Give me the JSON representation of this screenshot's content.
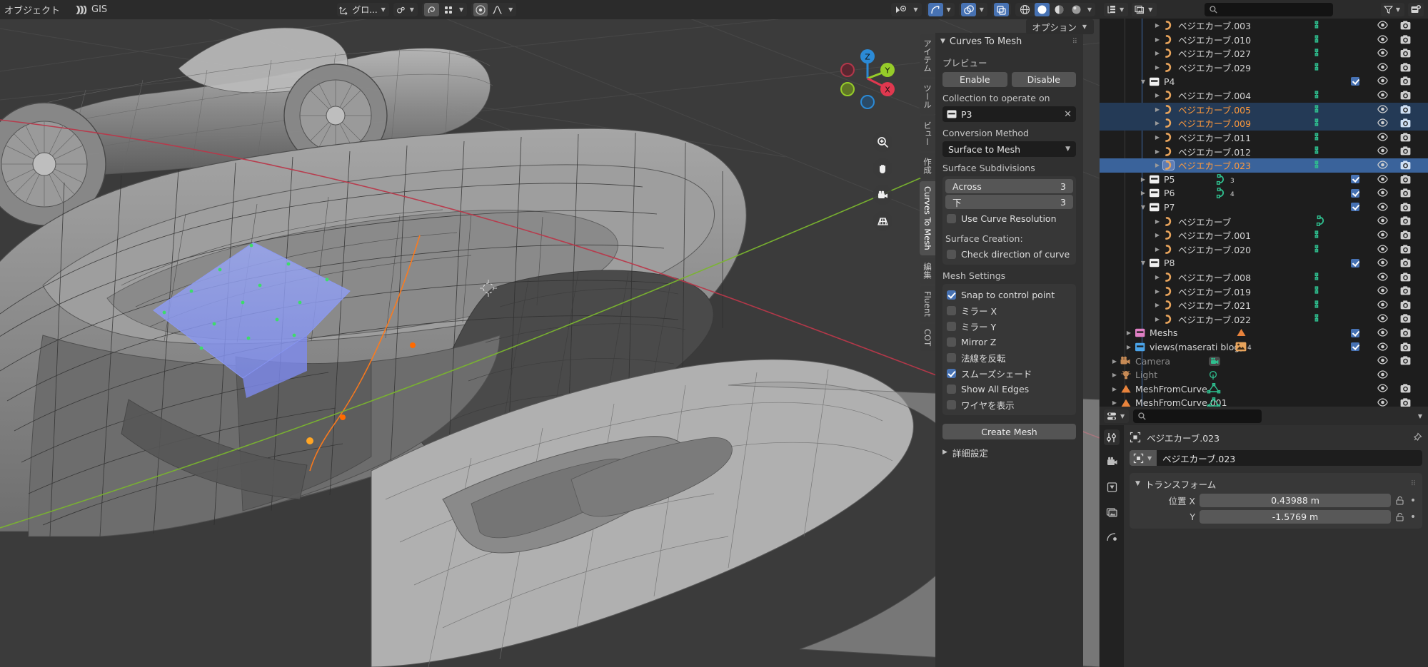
{
  "topbar": {
    "menu_object": "オブジェクト",
    "addon_label": "GIS",
    "transform_orientation": "グロ...",
    "options_label": "オプション"
  },
  "npanel": {
    "title": "Curves To Mesh",
    "preview_label": "プレビュー",
    "enable_label": "Enable",
    "disable_label": "Disable",
    "collection_label": "Collection to operate on",
    "collection_value": "P3",
    "conversion_label": "Conversion Method",
    "conversion_value": "Surface to Mesh",
    "subdiv_label": "Surface Subdivisions",
    "across_label": "Across",
    "across_value": "3",
    "down_label": "下",
    "down_value": "3",
    "use_curve_res_label": "Use Curve Resolution",
    "surface_creation_label": "Surface Creation:",
    "check_direction_label": "Check direction of curve",
    "mesh_settings_label": "Mesh Settings",
    "snap_label": "Snap to control point",
    "mirror_x_label": "ミラー X",
    "mirror_y_label": "ミラー Y",
    "mirror_z_label": "Mirror Z",
    "flip_normals_label": "法線を反転",
    "smooth_shade_label": "スムーズシェード",
    "show_all_edges_label": "Show All Edges",
    "show_wire_label": "ワイヤを表示",
    "create_mesh_label": "Create Mesh",
    "advanced_label": "詳細設定",
    "checks": {
      "use_curve_resolution": false,
      "check_direction": false,
      "snap_to_control_point": true,
      "mirror_x": false,
      "mirror_y": false,
      "mirror_z": false,
      "flip_normals": false,
      "smooth_shade": true,
      "show_all_edges": false,
      "show_wire": false
    }
  },
  "vtabs": [
    {
      "label": "アイテム",
      "active": false
    },
    {
      "label": "ツール",
      "active": false
    },
    {
      "label": "ビュー",
      "active": false
    },
    {
      "label": "作成",
      "active": false
    },
    {
      "label": "Curves To Mesh",
      "active": true
    },
    {
      "label": "編集",
      "active": false
    },
    {
      "label": "Fluent",
      "active": false
    },
    {
      "label": "COT",
      "active": false
    }
  ],
  "outliner": {
    "search_placeholder": "",
    "rows": [
      {
        "name": "ベジエカーブ.003",
        "type": "curve",
        "depth": 3,
        "sel": "none",
        "eye": true,
        "cam": true,
        "check": null
      },
      {
        "name": "ベジエカーブ.010",
        "type": "curve",
        "depth": 3,
        "sel": "none",
        "eye": true,
        "cam": true,
        "check": null
      },
      {
        "name": "ベジエカーブ.027",
        "type": "curve",
        "depth": 3,
        "sel": "none",
        "eye": true,
        "cam": true,
        "check": null
      },
      {
        "name": "ベジエカーブ.029",
        "type": "curve",
        "depth": 3,
        "sel": "none",
        "eye": true,
        "cam": true,
        "check": null
      },
      {
        "name": "P4",
        "type": "collection",
        "depth": 2,
        "sel": "none",
        "eye": true,
        "cam": true,
        "check": true,
        "expanded": true
      },
      {
        "name": "ベジエカーブ.004",
        "type": "curve",
        "depth": 3,
        "sel": "none",
        "eye": true,
        "cam": true,
        "check": null
      },
      {
        "name": "ベジエカーブ.005",
        "type": "curve",
        "depth": 3,
        "sel": "dim",
        "eye": true,
        "cam": true,
        "check": null
      },
      {
        "name": "ベジエカーブ.009",
        "type": "curve",
        "depth": 3,
        "sel": "dim",
        "eye": true,
        "cam": true,
        "check": null
      },
      {
        "name": "ベジエカーブ.011",
        "type": "curve",
        "depth": 3,
        "sel": "none",
        "eye": true,
        "cam": true,
        "check": null
      },
      {
        "name": "ベジエカーブ.012",
        "type": "curve",
        "depth": 3,
        "sel": "none",
        "eye": true,
        "cam": true,
        "check": null
      },
      {
        "name": "ベジエカーブ.023",
        "type": "curve",
        "depth": 3,
        "sel": "active",
        "eye": true,
        "cam": true,
        "check": null
      },
      {
        "name": "P5",
        "type": "collection",
        "depth": 2,
        "sel": "none",
        "eye": true,
        "cam": true,
        "check": true,
        "badge": "3"
      },
      {
        "name": "P6",
        "type": "collection",
        "depth": 2,
        "sel": "none",
        "eye": true,
        "cam": true,
        "check": true,
        "badge": "4"
      },
      {
        "name": "P7",
        "type": "collection",
        "depth": 2,
        "sel": "none",
        "eye": true,
        "cam": true,
        "check": true,
        "expanded": true
      },
      {
        "name": "ベジエカーブ",
        "type": "curve",
        "depth": 3,
        "sel": "none",
        "eye": true,
        "cam": true,
        "check": null
      },
      {
        "name": "ベジエカーブ.001",
        "type": "curve",
        "depth": 3,
        "sel": "none",
        "eye": true,
        "cam": true,
        "check": null
      },
      {
        "name": "ベジエカーブ.020",
        "type": "curve",
        "depth": 3,
        "sel": "none",
        "eye": true,
        "cam": true,
        "check": null
      },
      {
        "name": "P8",
        "type": "collection",
        "depth": 2,
        "sel": "none",
        "eye": true,
        "cam": true,
        "check": true,
        "expanded": true
      },
      {
        "name": "ベジエカーブ.008",
        "type": "curve",
        "depth": 3,
        "sel": "none",
        "eye": true,
        "cam": true,
        "check": null
      },
      {
        "name": "ベジエカーブ.019",
        "type": "curve",
        "depth": 3,
        "sel": "none",
        "eye": true,
        "cam": true,
        "check": null
      },
      {
        "name": "ベジエカーブ.021",
        "type": "curve",
        "depth": 3,
        "sel": "none",
        "eye": true,
        "cam": true,
        "check": null
      },
      {
        "name": "ベジエカーブ.022",
        "type": "curve",
        "depth": 3,
        "sel": "none",
        "eye": true,
        "cam": true,
        "check": null
      },
      {
        "name": "Meshs",
        "type": "collection-pink",
        "depth": 1,
        "sel": "none",
        "eye": true,
        "cam": true,
        "check": true,
        "tailicon": "mesh"
      },
      {
        "name": "views(maserati blog)",
        "type": "collection-blue",
        "depth": 1,
        "sel": "none",
        "eye": true,
        "cam": true,
        "check": true,
        "tailicon": "image",
        "badge": "4"
      },
      {
        "name": "Camera",
        "type": "camera",
        "depth": 0,
        "sel": "none",
        "eye": true,
        "cam": true,
        "check": null,
        "dim": true
      },
      {
        "name": "Light",
        "type": "light",
        "depth": 0,
        "sel": "none",
        "eye": true,
        "cam": false,
        "check": null,
        "dim": true
      },
      {
        "name": "MeshFromCurve",
        "type": "mesh",
        "depth": 0,
        "sel": "none",
        "eye": true,
        "cam": true,
        "check": null
      },
      {
        "name": "MeshFromCurve.001",
        "type": "mesh",
        "depth": 0,
        "sel": "none",
        "eye": true,
        "cam": true,
        "check": null
      }
    ]
  },
  "properties": {
    "search_placeholder": "",
    "breadcrumb_object": "ベジエカーブ.023",
    "name_field_value": "ベジエカーブ.023",
    "transform_title": "トランスフォーム",
    "fields": [
      {
        "label": "位置 X",
        "value": "0.43988 m"
      },
      {
        "label": "Y",
        "value": "-1.5769 m"
      }
    ]
  },
  "colors": {
    "accent_blue": "#4772b3",
    "curve_orange": "#e8a45c",
    "active_text": "#ff9a3c",
    "select_row": "#3a639b",
    "select_row_dim": "#243a56",
    "axis_x_red": "#e0384f",
    "axis_y_green": "#96cc29",
    "axis_z_blue": "#2b8ad6"
  }
}
